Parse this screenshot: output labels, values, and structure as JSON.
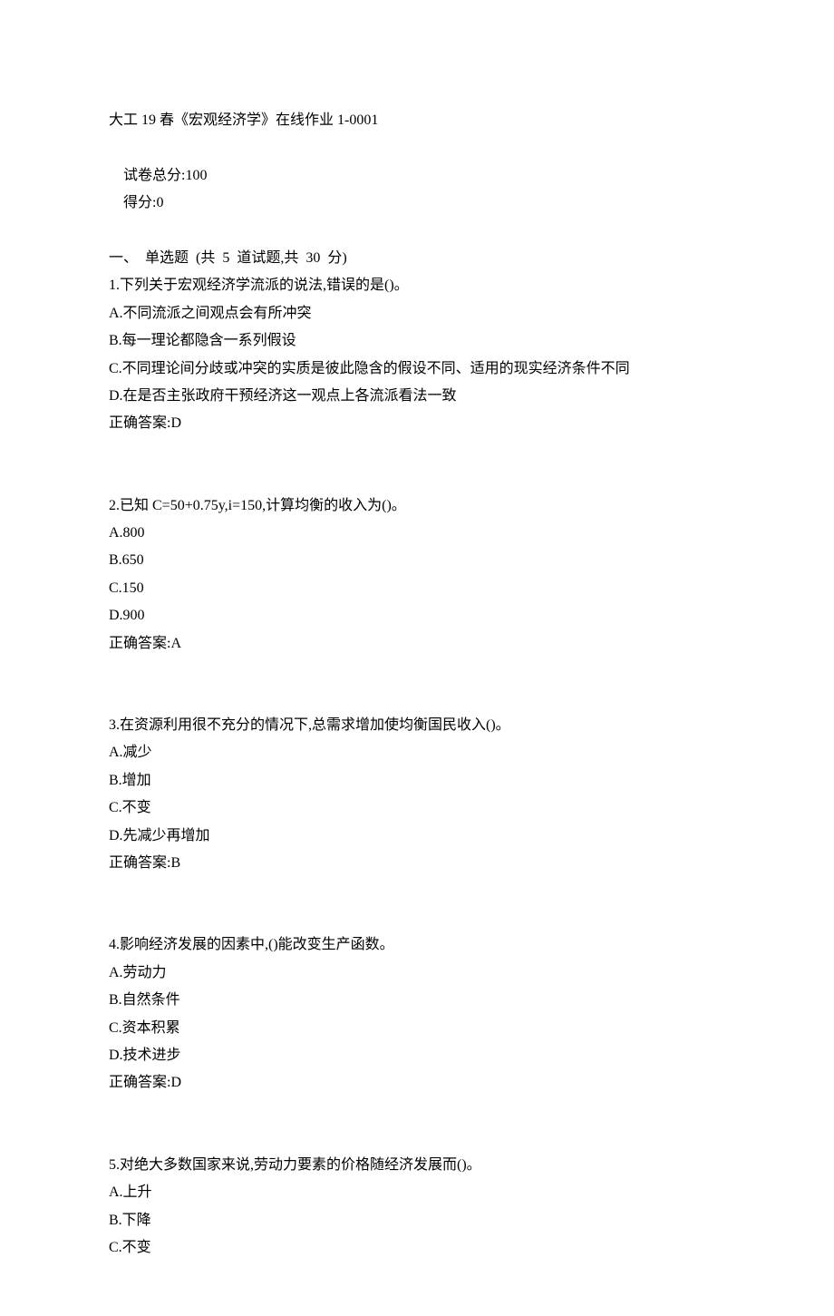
{
  "header": {
    "title": "大工 19 春《宏观经济学》在线作业 1-0001",
    "total_label": "试卷总分:100",
    "score_label": "得分:0",
    "section_label": "一、  单选题  (共  5  道试题,共  30  分)"
  },
  "q1": {
    "prompt": "1.下列关于宏观经济学流派的说法,错误的是()。",
    "a": "A.不同流派之间观点会有所冲突",
    "b": "B.每一理论都隐含一系列假设",
    "c": "C.不同理论间分歧或冲突的实质是彼此隐含的假设不同、适用的现实经济条件不同",
    "d": "D.在是否主张政府干预经济这一观点上各流派看法一致",
    "ans": "正确答案:D"
  },
  "q2": {
    "prompt": "2.已知 C=50+0.75y,i=150,计算均衡的收入为()。",
    "a": "A.800",
    "b": "B.650",
    "c": "C.150",
    "d": "D.900",
    "ans": "正确答案:A"
  },
  "q3": {
    "prompt": "3.在资源利用很不充分的情况下,总需求增加使均衡国民收入()。",
    "a": "A.减少",
    "b": "B.增加",
    "c": "C.不变",
    "d": "D.先减少再增加",
    "ans": "正确答案:B"
  },
  "q4": {
    "prompt": "4.影响经济发展的因素中,()能改变生产函数。",
    "a": "A.劳动力",
    "b": "B.自然条件",
    "c": "C.资本积累",
    "d": "D.技术进步",
    "ans": "正确答案:D"
  },
  "q5": {
    "prompt": "5.对绝大多数国家来说,劳动力要素的价格随经济发展而()。",
    "a": "A.上升",
    "b": "B.下降",
    "c": "C.不变"
  }
}
